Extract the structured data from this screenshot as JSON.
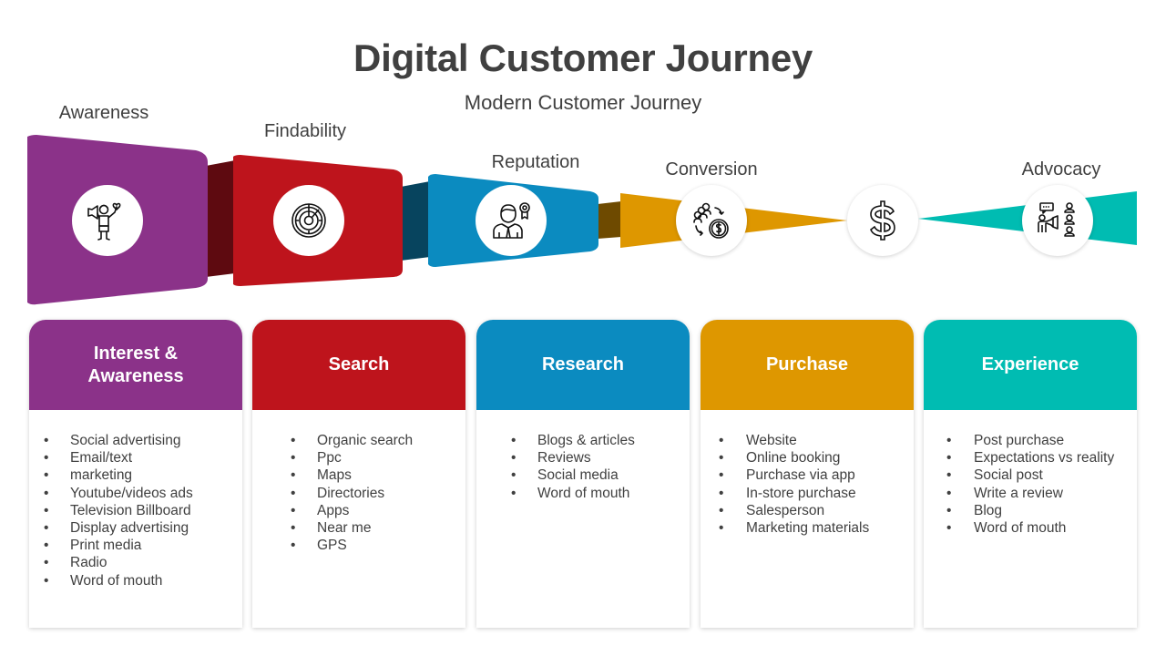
{
  "title": "Digital Customer Journey",
  "subtitle": "Modern Customer Journey",
  "colors": {
    "purple": "#8B3289",
    "red": "#BE141C",
    "blue": "#0B8BC0",
    "gold": "#DE9700",
    "teal": "#00BCB2",
    "text": "#404040"
  },
  "stages": [
    {
      "label": "Awareness",
      "icon": "person-megaphone-heart-icon"
    },
    {
      "label": "Findability",
      "icon": "radar-target-icon"
    },
    {
      "label": "Reputation",
      "icon": "person-award-badge-icon"
    },
    {
      "label": "Conversion",
      "icon": "people-cycle-coin-icon"
    },
    {
      "label": "",
      "icon": "dollar-sign-icon"
    },
    {
      "label": "Advocacy",
      "icon": "presenter-audience-icon"
    }
  ],
  "cards": [
    {
      "title": "Interest & Awareness",
      "items": [
        "Social advertising",
        "Email/text",
        "marketing",
        "Youtube/videos ads",
        "Television Billboard",
        "Display advertising",
        "Print media",
        "Radio",
        "Word of mouth"
      ]
    },
    {
      "title": "Search",
      "items": [
        "Organic search",
        "Ppc",
        "Maps",
        "Directories",
        "Apps",
        "Near me",
        "GPS"
      ]
    },
    {
      "title": "Research",
      "items": [
        "Blogs & articles",
        "Reviews",
        "Social media",
        "Word of mouth"
      ]
    },
    {
      "title": "Purchase",
      "items": [
        "Website",
        "Online booking",
        "Purchase via app",
        "In-store purchase",
        "Salesperson",
        "Marketing materials"
      ]
    },
    {
      "title": "Experience",
      "items": [
        "Post purchase",
        "Expectations  vs reality",
        "Social post",
        "Write a review",
        "Blog",
        "Word of mouth"
      ]
    }
  ]
}
